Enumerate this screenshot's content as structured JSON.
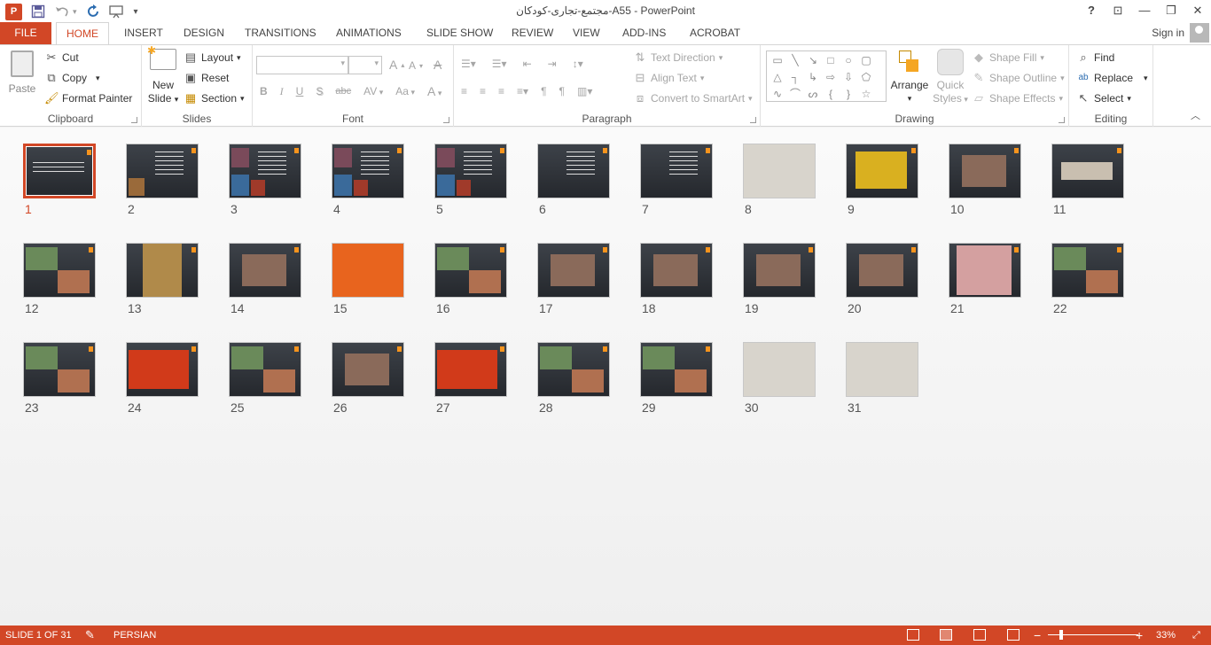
{
  "app": {
    "title": "مجتمع-تجاری-کودکان-A55 - PowerPoint"
  },
  "window": {
    "help": "?",
    "restore_ribbon": "⊡",
    "minimize": "—",
    "maximize": "❐",
    "close": "✕"
  },
  "qat": {
    "logo": "P",
    "save_icon": "save-icon",
    "undo_icon": "undo-icon",
    "redo_icon": "repeat-icon",
    "start_icon": "start-from-beginning-icon",
    "customize": "▾"
  },
  "tabs": [
    {
      "label": "FILE"
    },
    {
      "label": "HOME"
    },
    {
      "label": "INSERT"
    },
    {
      "label": "DESIGN"
    },
    {
      "label": "TRANSITIONS"
    },
    {
      "label": "ANIMATIONS"
    },
    {
      "label": "SLIDE SHOW"
    },
    {
      "label": "REVIEW"
    },
    {
      "label": "VIEW"
    },
    {
      "label": "ADD-INS"
    },
    {
      "label": "ACROBAT"
    }
  ],
  "signin": "Sign in",
  "ribbon": {
    "clipboard": {
      "label": "Clipboard",
      "paste": "Paste",
      "cut": "Cut",
      "copy": "Copy",
      "format_painter": "Format Painter"
    },
    "slides": {
      "label": "Slides",
      "new_slide_1": "New",
      "new_slide_2": "Slide",
      "layout": "Layout",
      "reset": "Reset",
      "section": "Section"
    },
    "font": {
      "label": "Font",
      "bold": "B",
      "italic": "I",
      "underline": "U",
      "shadow": "S",
      "strike": "abc",
      "spacing": "AV",
      "case": "Aa",
      "grow": "A",
      "shrink": "A",
      "clear": "A",
      "color": "A"
    },
    "paragraph": {
      "label": "Paragraph",
      "text_direction": "Text Direction",
      "align_text": "Align Text",
      "convert_smartart": "Convert to SmartArt"
    },
    "drawing": {
      "label": "Drawing",
      "arrange": "Arrange",
      "quick_styles_1": "Quick",
      "quick_styles_2": "Styles",
      "shape_fill": "Shape Fill",
      "shape_outline": "Shape Outline",
      "shape_effects": "Shape Effects"
    },
    "editing": {
      "label": "Editing",
      "find": "Find",
      "replace": "Replace",
      "select": "Select"
    }
  },
  "slides": [
    {
      "num": "1",
      "selected": true,
      "type": "title"
    },
    {
      "num": "2",
      "type": "text-pic"
    },
    {
      "num": "3",
      "type": "collage"
    },
    {
      "num": "4",
      "type": "collage"
    },
    {
      "num": "5",
      "type": "collage"
    },
    {
      "num": "6",
      "type": "text"
    },
    {
      "num": "7",
      "type": "text"
    },
    {
      "num": "8",
      "type": "photo-light"
    },
    {
      "num": "9",
      "type": "photo-yellow"
    },
    {
      "num": "10",
      "type": "photo-center"
    },
    {
      "num": "11",
      "type": "photo-wide"
    },
    {
      "num": "12",
      "type": "two-pics"
    },
    {
      "num": "13",
      "type": "photo-tall"
    },
    {
      "num": "14",
      "type": "photo-center"
    },
    {
      "num": "15",
      "type": "photo-orange"
    },
    {
      "num": "16",
      "type": "two-pics"
    },
    {
      "num": "17",
      "type": "photo-center"
    },
    {
      "num": "18",
      "type": "photo-center"
    },
    {
      "num": "19",
      "type": "photo-center"
    },
    {
      "num": "20",
      "type": "photo-center"
    },
    {
      "num": "21",
      "type": "photo-pink"
    },
    {
      "num": "22",
      "type": "two-pics"
    },
    {
      "num": "23",
      "type": "two-pics"
    },
    {
      "num": "24",
      "type": "photo-red"
    },
    {
      "num": "25",
      "type": "two-pics"
    },
    {
      "num": "26",
      "type": "photo-center"
    },
    {
      "num": "27",
      "type": "photo-red"
    },
    {
      "num": "28",
      "type": "two-pics"
    },
    {
      "num": "29",
      "type": "two-pics"
    },
    {
      "num": "30",
      "type": "photo-light"
    },
    {
      "num": "31",
      "type": "photo-light"
    }
  ],
  "status": {
    "slide_info": "SLIDE 1 OF 31",
    "language": "PERSIAN",
    "zoom": "33%",
    "zoom_out": "−",
    "zoom_in": "+",
    "zoom_level": 0.33
  },
  "colors": {
    "accent": "#d24726",
    "slide_bg": "#2f3338",
    "slide_accent": "#f7941d"
  }
}
